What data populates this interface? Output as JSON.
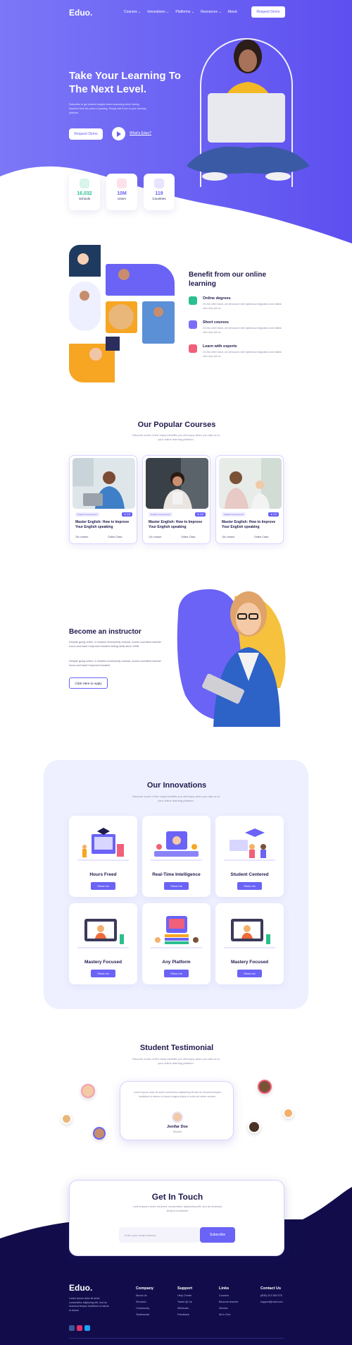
{
  "header": {
    "logo": "Eduo.",
    "nav": [
      "Courses ⌄",
      "Innovations ⌄",
      "Platforms ⌄",
      "Resources ⌄",
      "About"
    ],
    "cta": "Request Demo"
  },
  "hero": {
    "title": "Take Your Learning To The Next Level.",
    "subtitle": "Subscribe to get student insights when assessing while freeing teachers from the pains of grading. Simply add Eduo to your learning platform.",
    "primary_button": "Request Demo",
    "video_link": "What's Eduo?",
    "stats": [
      {
        "value": "16,032",
        "label": "Schools",
        "color": "#2bbf8f"
      },
      {
        "value": "10M",
        "label": "Users",
        "color": "#f06b9a"
      },
      {
        "value": "119",
        "label": "Countries",
        "color": "#6a63f6"
      }
    ]
  },
  "benefit": {
    "title": "Benefit from our online learning",
    "items": [
      {
        "title": "Online degrees",
        "desc": "On the other hand, we denounce with righteous indignation and dislike men who are so",
        "color": "#2bbf8f"
      },
      {
        "title": "Short courses",
        "desc": "On the other hand, we denounce with righteous indignation and dislike men who are so",
        "color": "#7b6cf6"
      },
      {
        "title": "Learn with experts",
        "desc": "On the other hand, we denounce with righteous indignation and dislike men who are so",
        "color": "#f0607a"
      }
    ]
  },
  "courses": {
    "title": "Our Popular Courses",
    "subtitle": "Discover some of the many benefits you will enjoy when you add us to your online learning platform.",
    "items": [
      {
        "tag": "English Improvement",
        "rating": "★ 4.8",
        "title": "Master English: How to Improve Your English speaking",
        "lessons": "15x Lesson",
        "mode": "Online Class"
      },
      {
        "tag": "English Improvement",
        "rating": "★ 4.8",
        "title": "Master English: How to Improve Your English speaking",
        "lessons": "14x Lesson",
        "mode": "Online Class"
      },
      {
        "tag": "English Improvement",
        "rating": "★ 4.9",
        "title": "Master English: How to Improve Your English speaking",
        "lessons": "15x Lesson",
        "mode": "Online Class"
      }
    ]
  },
  "instructor": {
    "title": "Become an instructor",
    "p1": "Despite going online, it remains excessively manual, scores countless teacher hours and hasn't improved student writing skills since 1898.",
    "p2": "Despite going online, it remains excessively manual, scores countless teacher hours and hasn't improved student",
    "button": "Click Here to Apply"
  },
  "innovations": {
    "title": "Our Innovations",
    "subtitle": "Discover some of the many benefits you will enjoy when you add us to your online learning platform.",
    "items": [
      {
        "title": "Hours Freed",
        "button": "Show me"
      },
      {
        "title": "Real-Time Intelligence",
        "button": "Show me"
      },
      {
        "title": "Student Centered",
        "button": "Show me"
      },
      {
        "title": "Mastery Focused",
        "button": "Show me"
      },
      {
        "title": "Any Platform",
        "button": "Show me"
      },
      {
        "title": "Mastery Focused",
        "button": "Show me"
      }
    ]
  },
  "testimonial": {
    "title": "Student Testimonial",
    "subtitle": "Discover some of the many benefits you will enjoy when you add us to your online learning platform.",
    "quote": "Lorem ipsum dolor sit amet consectetur adipiscing elit sed do eiusmod tempor incididunt ut labore et dolore magna aliqua ut enim ad minim veniam.",
    "name": "Jenifar Doe",
    "role": "Student"
  },
  "touch": {
    "title": "Get In Touch",
    "subtitle": "Lorem ipsum dolor sit amet, consectetur adipiscing elit, sed do eiusmod tempor incididunt",
    "email_placeholder": "Enter your email address",
    "button": "Subscribe"
  },
  "footer": {
    "logo": "Eduo.",
    "desc": "Lorem ipsum dolor sit amet, consectetur adipiscing elit, sed do eiusmod tempor incididunt ut labore et dolore",
    "columns": [
      {
        "title": "Company",
        "items": [
          "About Us",
          "Services",
          "Community",
          "Testimonial"
        ]
      },
      {
        "title": "Support",
        "items": [
          "Help Center",
          "Tweet @ Us",
          "Webinars",
          "Feedback"
        ]
      },
      {
        "title": "Links",
        "items": [
          "Courses",
          "Become teacher",
          "Service",
          "All in One"
        ]
      },
      {
        "title": "Contact Us",
        "items": [
          "(808) 113 345 678",
          "support@mail.com"
        ]
      }
    ]
  }
}
